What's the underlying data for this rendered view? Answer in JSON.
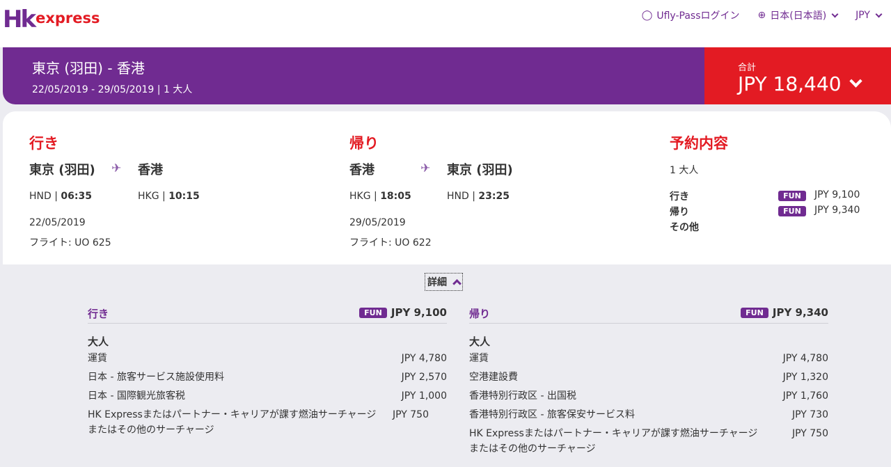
{
  "header": {
    "logo_hk": "Hk",
    "logo_express": "express",
    "nav": {
      "login": "Ufly-Passログイン",
      "language": "日本(日本語)",
      "currency": "JPY"
    }
  },
  "summary": {
    "route": "東京 (羽田) - 香港",
    "dates": "22/05/2019 - 29/05/2019 | 1 大人",
    "total_label": "合計",
    "total_amount": "JPY 18,440"
  },
  "outbound": {
    "title": "行き",
    "from_city": "東京 (羽田)",
    "to_city": "香港",
    "from_code": "HND |",
    "from_time": "06:35",
    "to_code": "HKG |",
    "to_time": "10:15",
    "date": "22/05/2019",
    "flight": "フライト: UO 625"
  },
  "inbound": {
    "title": "帰り",
    "from_city": "香港",
    "to_city": "東京 (羽田)",
    "from_code": "HKG |",
    "from_time": "18:05",
    "to_code": "HND |",
    "to_time": "23:25",
    "date": "29/05/2019",
    "flight": "フライト: UO 622"
  },
  "booking": {
    "title": "予約内容",
    "pax": "1 大人",
    "rows": [
      {
        "label": "行き",
        "fare": "FUN",
        "price": "JPY 9,100"
      },
      {
        "label": "帰り",
        "fare": "FUN",
        "price": "JPY 9,340"
      },
      {
        "label": "その他",
        "fare": "",
        "price": ""
      }
    ]
  },
  "details": {
    "toggle_label": "詳細",
    "outbound": {
      "title": "行き",
      "fare": "FUN",
      "amount": "JPY 9,100",
      "adult_label": "大人",
      "fees": [
        {
          "name": "運賃",
          "amount": "JPY 4,780"
        },
        {
          "name": "日本 - 旅客サービス施設使用料",
          "amount": "JPY 2,570"
        },
        {
          "name": "日本 - 国際観光旅客税",
          "amount": "JPY 1,000"
        },
        {
          "name": "HK Expressまたはパートナー・キャリアが課す燃油サーチャージまたはその他のサーチャージ",
          "amount": "JPY 750"
        }
      ]
    },
    "inbound": {
      "title": "帰り",
      "fare": "FUN",
      "amount": "JPY 9,340",
      "adult_label": "大人",
      "fees": [
        {
          "name": "運賃",
          "amount": "JPY 4,780"
        },
        {
          "name": "空港建設費",
          "amount": "JPY 1,320"
        },
        {
          "name": "香港特別行政区 - 出国税",
          "amount": "JPY 1,760"
        },
        {
          "name": "香港特別行政区 - 旅客保安サービス料",
          "amount": "JPY 730"
        },
        {
          "name": "HK Expressまたはパートナー・キャリアが課す燃油サーチャージまたはその他のサーチャージ",
          "amount": "JPY 750"
        }
      ]
    }
  },
  "colors": {
    "brand_purple": "#702b91",
    "brand_red": "#e31b23"
  }
}
